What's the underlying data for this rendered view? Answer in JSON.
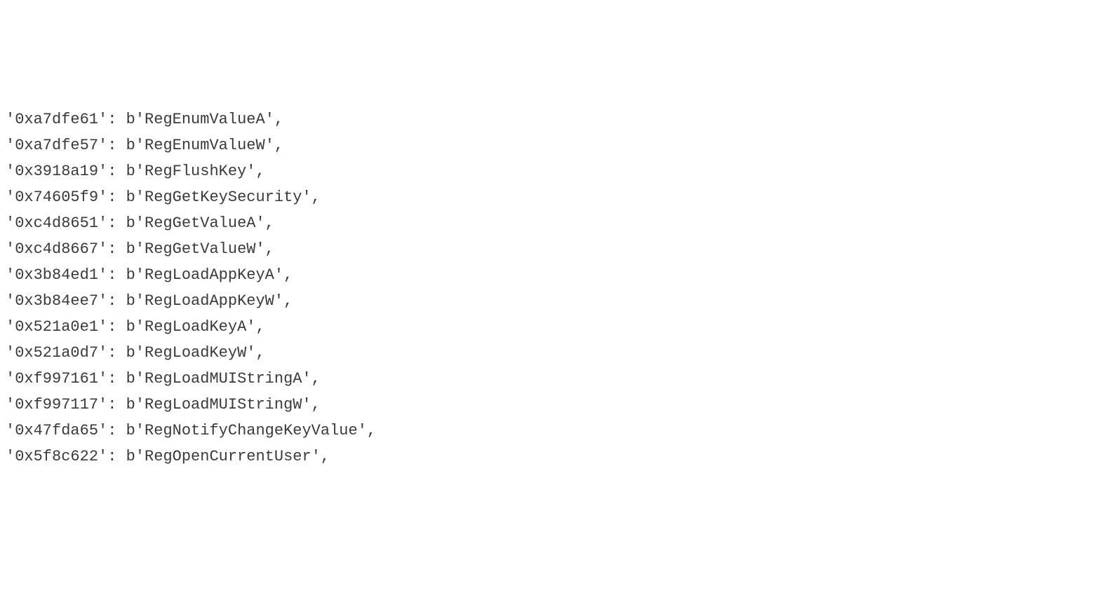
{
  "lines": [
    {
      "key": "'0xa7dfe61'",
      "sep": ": b'",
      "value": "RegEnumValueA",
      "suffix": "',"
    },
    {
      "key": "'0xa7dfe57'",
      "sep": ": b'",
      "value": "RegEnumValueW",
      "suffix": "',"
    },
    {
      "key": "'0x3918a19'",
      "sep": ": b'",
      "value": "RegFlushKey",
      "suffix": "',"
    },
    {
      "key": "'0x74605f9'",
      "sep": ": b'",
      "value": "RegGetKeySecurity",
      "suffix": "',"
    },
    {
      "key": "'0xc4d8651'",
      "sep": ": b'",
      "value": "RegGetValueA",
      "suffix": "',"
    },
    {
      "key": "'0xc4d8667'",
      "sep": ": b'",
      "value": "RegGetValueW",
      "suffix": "',"
    },
    {
      "key": "'0x3b84ed1'",
      "sep": ": b'",
      "value": "RegLoadAppKeyA",
      "suffix": "',"
    },
    {
      "key": "'0x3b84ee7'",
      "sep": ": b'",
      "value": "RegLoadAppKeyW",
      "suffix": "',"
    },
    {
      "key": "'0x521a0e1'",
      "sep": ": b'",
      "value": "RegLoadKeyA",
      "suffix": "',"
    },
    {
      "key": "'0x521a0d7'",
      "sep": ": b'",
      "value": "RegLoadKeyW",
      "suffix": "',"
    },
    {
      "key": "'0xf997161'",
      "sep": ": b'",
      "value": "RegLoadMUIStringA",
      "suffix": "',"
    },
    {
      "key": "'0xf997117'",
      "sep": ": b'",
      "value": "RegLoadMUIStringW",
      "suffix": "',"
    },
    {
      "key": "'0x47fda65'",
      "sep": ": b'",
      "value": "RegNotifyChangeKeyValue",
      "suffix": "',"
    },
    {
      "key": "'0x5f8c622'",
      "sep": ": b'",
      "value": "RegOpenCurrentUser",
      "suffix": "',"
    }
  ]
}
